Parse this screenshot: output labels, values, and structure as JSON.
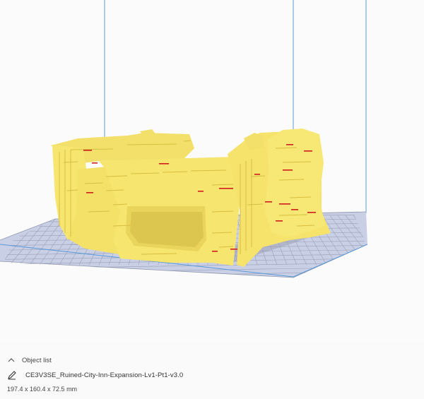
{
  "viewport": {
    "bed_color": "#c7cde2",
    "grid_line_color": "#8f97ad",
    "model_color": "#f6e56e",
    "model_shadow_color": "#e5c647",
    "overhang_color": "#d11d1d",
    "volume_line_color": "#5a9bd8",
    "background_color": "#fbfbfb"
  },
  "object_list": {
    "header_label": "Object list",
    "chevron_icon": "chevron-up-icon",
    "edit_icon": "pencil-icon",
    "object_name": "CE3V3SE_Ruined-City-Inn-Expansion-Lv1-Pt1-v3.0",
    "dimensions": "197.4 x 160.4 x 72.5 mm"
  }
}
